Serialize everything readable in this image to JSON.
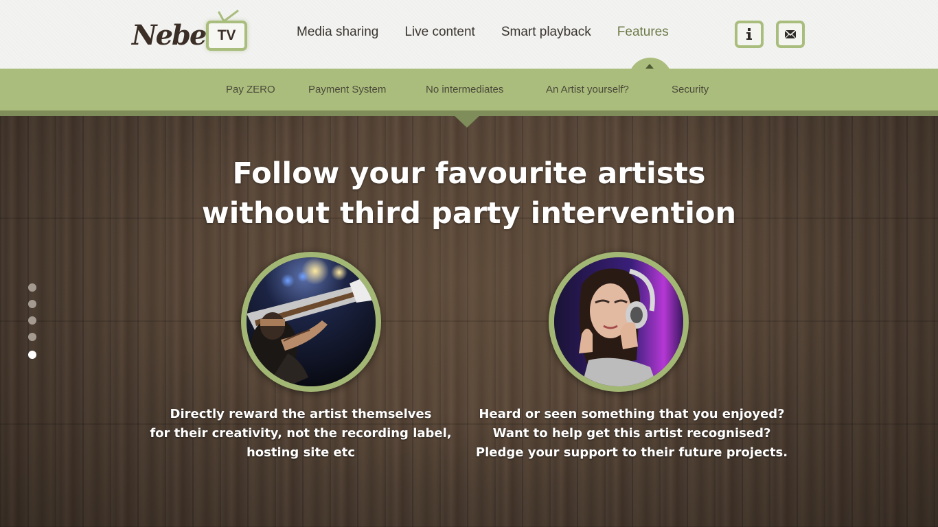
{
  "brand": {
    "logo_text": "Nebel.",
    "logo_badge": "TV"
  },
  "main_nav": {
    "items": [
      {
        "label": "Media sharing"
      },
      {
        "label": "Live content"
      },
      {
        "label": "Smart playback"
      },
      {
        "label": "Features",
        "active": true
      }
    ]
  },
  "header_icons": [
    {
      "name": "info-icon"
    },
    {
      "name": "mail-icon"
    }
  ],
  "sub_nav": {
    "items": [
      {
        "label": "Pay ZERO"
      },
      {
        "label": "Payment System"
      },
      {
        "label": "No intermediates",
        "active": true
      },
      {
        "label": "An Artist yourself?"
      },
      {
        "label": "Security"
      }
    ]
  },
  "hero": {
    "headline_line1": "Follow your favourite artists",
    "headline_line2": "without third party intervention"
  },
  "features": [
    {
      "image": "guitarist-photo",
      "lines": [
        "Directly reward the artist themselves",
        "for their creativity, not the recording label,",
        "hosting site etc"
      ]
    },
    {
      "image": "headphones-listener-photo",
      "lines": [
        "Heard or seen something that you enjoyed?",
        "Want to help get this artist recognised?",
        "Pledge your support to their future projects."
      ]
    }
  ],
  "pager": {
    "total": 5,
    "active": 5
  },
  "colors": {
    "accent_green": "#abbd7c",
    "dark_green": "#7e8d59",
    "header_bg": "#f3f3f1",
    "wood": "#534336",
    "text_dark": "#3a342f"
  }
}
